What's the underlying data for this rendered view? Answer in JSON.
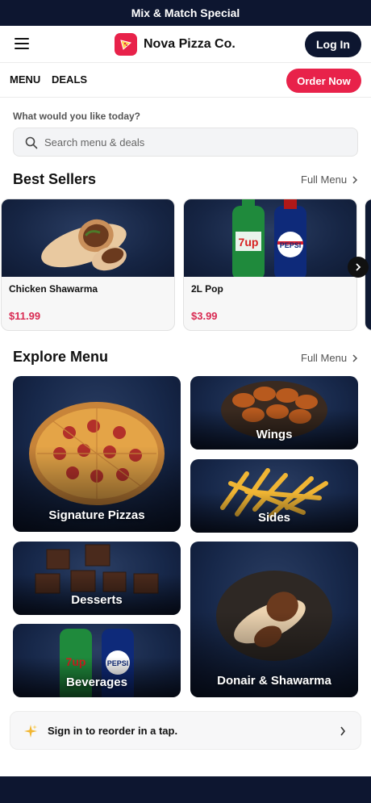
{
  "promo": {
    "text": "Mix & Match Special"
  },
  "header": {
    "brand": "Nova Pizza Co.",
    "login_label": "Log In"
  },
  "nav": {
    "menu_label": "MENU",
    "deals_label": "DEALS",
    "order_label": "Order Now"
  },
  "search": {
    "prompt": "What would you like today?",
    "placeholder": "Search menu & deals"
  },
  "best_sellers": {
    "title": "Best Sellers",
    "link": "Full Menu",
    "items": [
      {
        "name": "Chicken Shawarma",
        "price": "$11.99"
      },
      {
        "name": "2L Pop",
        "price": "$3.99"
      }
    ]
  },
  "explore": {
    "title": "Explore Menu",
    "link": "Full Menu",
    "tiles": [
      {
        "label": "Signature Pizzas"
      },
      {
        "label": "Wings"
      },
      {
        "label": "Sides"
      },
      {
        "label": "Desserts"
      },
      {
        "label": "Donair & Shawarma"
      },
      {
        "label": "Beverages"
      }
    ]
  },
  "reorder": {
    "text": "Sign in to reorder in a tap."
  },
  "colors": {
    "navy": "#0d1630",
    "accent_red": "#e8224a",
    "price_red": "#d92a52"
  }
}
